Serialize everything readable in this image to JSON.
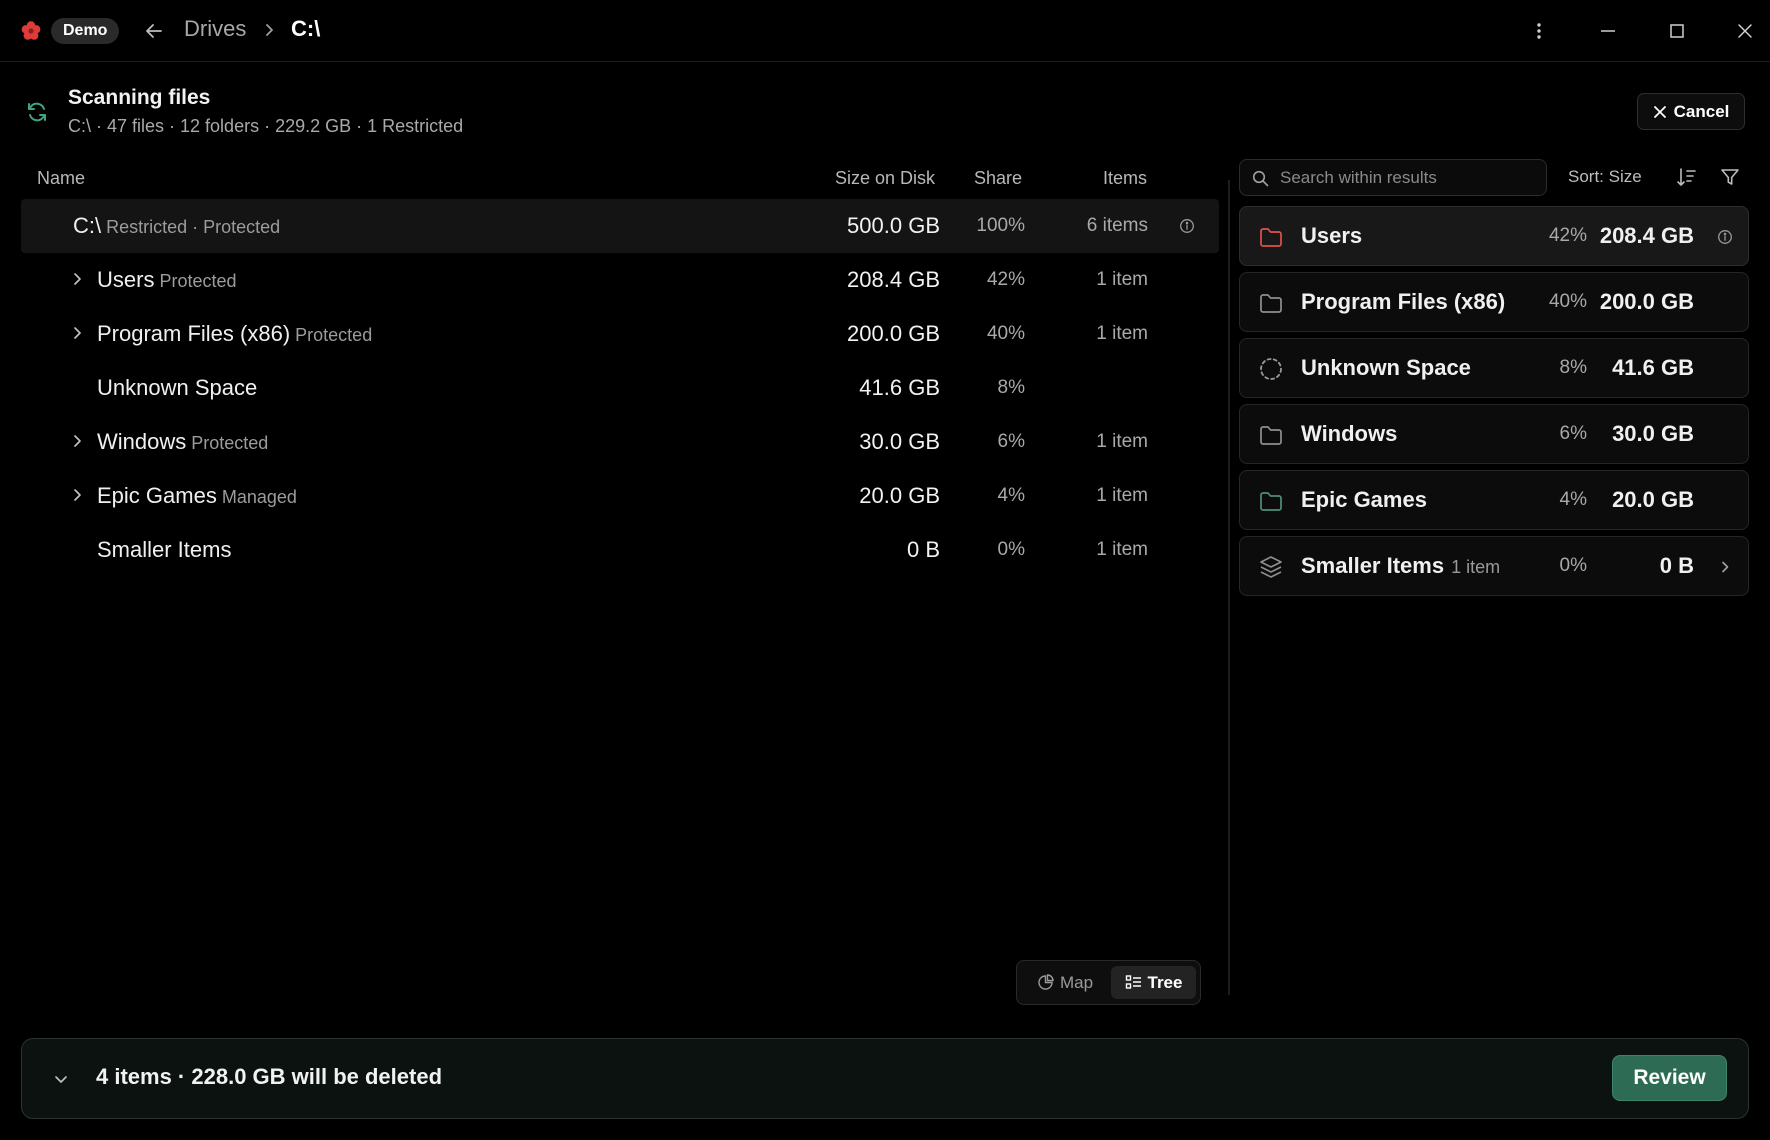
{
  "titlebar": {
    "badge": "Demo",
    "breadcrumb": [
      "Drives",
      "C:\\"
    ]
  },
  "scan": {
    "title": "Scanning files",
    "subtitle": "C:\\ · 47 files · 12 folders · 229.2 GB · 1 Restricted",
    "cancel_label": "Cancel"
  },
  "table": {
    "headers": {
      "name": "Name",
      "size": "Size on Disk",
      "share": "Share",
      "items": "Items"
    },
    "rows": [
      {
        "name": "C:\\",
        "tag": "Restricted · Protected",
        "size": "500.0 GB",
        "share": "100%",
        "items": "6 items"
      },
      {
        "name": "Users",
        "tag": "Protected",
        "size": "208.4 GB",
        "share": "42%",
        "items": "1 item"
      },
      {
        "name": "Program Files (x86)",
        "tag": "Protected",
        "size": "200.0 GB",
        "share": "40%",
        "items": "1 item"
      },
      {
        "name": "Unknown Space",
        "tag": "",
        "size": "41.6 GB",
        "share": "8%",
        "items": ""
      },
      {
        "name": "Windows",
        "tag": "Protected",
        "size": "30.0 GB",
        "share": "6%",
        "items": "1 item"
      },
      {
        "name": "Epic Games",
        "tag": "Managed",
        "size": "20.0 GB",
        "share": "4%",
        "items": "1 item"
      },
      {
        "name": "Smaller Items",
        "tag": "",
        "size": "0 B",
        "share": "0%",
        "items": "1 item"
      }
    ]
  },
  "view_toggle": {
    "map": "Map",
    "tree": "Tree",
    "active": "Tree"
  },
  "results": {
    "search_placeholder": "Search within results",
    "sort_label": "Sort: Size",
    "cards": [
      {
        "name": "Users",
        "sub": "",
        "share": "42%",
        "size": "208.4 GB",
        "icon": "folder-icon",
        "color": "#e0524a"
      },
      {
        "name": "Program Files (x86)",
        "sub": "",
        "share": "40%",
        "size": "200.0 GB",
        "icon": "folder-icon",
        "color": "#8f8f8f"
      },
      {
        "name": "Unknown Space",
        "sub": "",
        "share": "8%",
        "size": "41.6 GB",
        "icon": "dashed-circle-icon",
        "color": "#9a9a9a"
      },
      {
        "name": "Windows",
        "sub": "",
        "share": "6%",
        "size": "30.0 GB",
        "icon": "folder-icon",
        "color": "#8f8f8f"
      },
      {
        "name": "Epic Games",
        "sub": "",
        "share": "4%",
        "size": "20.0 GB",
        "icon": "folder-icon",
        "color": "#4f8f76"
      },
      {
        "name": "Smaller Items",
        "sub": "1 item",
        "share": "0%",
        "size": "0 B",
        "icon": "layers-icon",
        "color": "#8f8f8f"
      }
    ]
  },
  "deletion_bar": {
    "summary": "4 items · 228.0 GB will be deleted",
    "review_label": "Review",
    "accent": "#2d6b55"
  }
}
